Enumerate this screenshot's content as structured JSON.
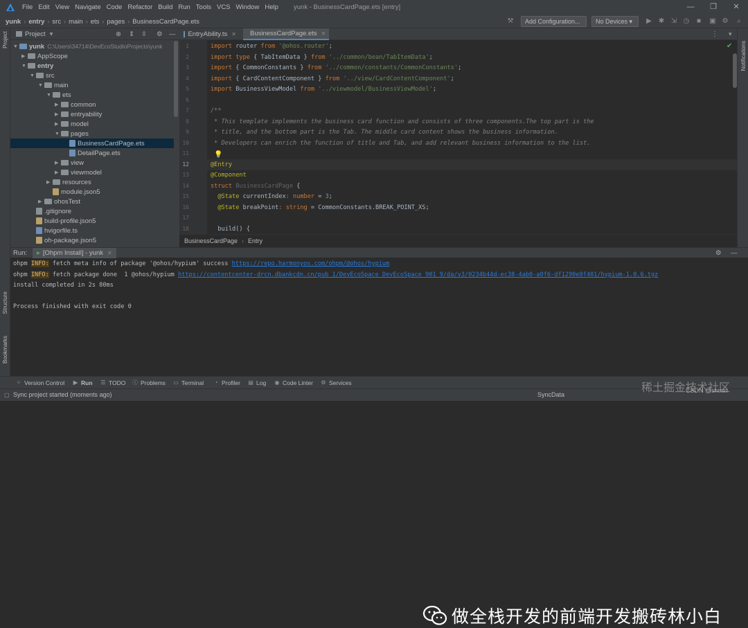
{
  "menubar": {
    "items": [
      "File",
      "Edit",
      "View",
      "Navigate",
      "Code",
      "Refactor",
      "Build",
      "Run",
      "Tools",
      "VCS",
      "Window",
      "Help"
    ],
    "window_title": "yunk - BusinessCardPage.ets [entry]"
  },
  "navbar": {
    "crumbs": [
      "yunk",
      "entry",
      "src",
      "main",
      "ets",
      "pages",
      "BusinessCardPage.ets"
    ],
    "add_config_label": "Add Configuration...",
    "devices_label": "No Devices"
  },
  "left_strip": {
    "project_label": "Project",
    "structure_label": "Structure",
    "bookmarks_label": "Bookmarks"
  },
  "right_strip": {
    "notifications_label": "Notifications"
  },
  "project": {
    "header_label": "Project",
    "tree": [
      {
        "label": "yunk",
        "extra": "C:\\Users\\34714\\DevEcoStudioProjects\\yunk",
        "depth": 0,
        "kind": "folder",
        "open": true
      },
      {
        "label": "AppScope",
        "depth": 1,
        "kind": "folder",
        "open": false
      },
      {
        "label": "entry",
        "depth": 1,
        "kind": "folder",
        "open": true
      },
      {
        "label": "src",
        "depth": 2,
        "kind": "folder",
        "open": true
      },
      {
        "label": "main",
        "depth": 3,
        "kind": "folder",
        "open": true
      },
      {
        "label": "ets",
        "depth": 4,
        "kind": "folder",
        "open": true
      },
      {
        "label": "common",
        "depth": 5,
        "kind": "folder",
        "open": false
      },
      {
        "label": "entryability",
        "depth": 5,
        "kind": "folder",
        "open": false
      },
      {
        "label": "model",
        "depth": 5,
        "kind": "folder",
        "open": false
      },
      {
        "label": "pages",
        "depth": 5,
        "kind": "folder",
        "open": true
      },
      {
        "label": "BusinessCardPage.ets",
        "depth": 6,
        "kind": "ets",
        "selected": true
      },
      {
        "label": "DetailPage.ets",
        "depth": 6,
        "kind": "ets"
      },
      {
        "label": "view",
        "depth": 5,
        "kind": "folder",
        "open": false
      },
      {
        "label": "viewmodel",
        "depth": 5,
        "kind": "folder",
        "open": false
      },
      {
        "label": "resources",
        "depth": 4,
        "kind": "folder",
        "open": false
      },
      {
        "label": "module.json5",
        "depth": 4,
        "kind": "json"
      },
      {
        "label": "ohosTest",
        "depth": 3,
        "kind": "folder",
        "open": false
      },
      {
        "label": ".gitignore",
        "depth": 2,
        "kind": "text"
      },
      {
        "label": "build-profile.json5",
        "depth": 2,
        "kind": "json"
      },
      {
        "label": "hvigorfile.ts",
        "depth": 2,
        "kind": "ts"
      },
      {
        "label": "oh-package.json5",
        "depth": 2,
        "kind": "json"
      }
    ]
  },
  "editor": {
    "tabs": [
      {
        "label": "EntryAbility.ts",
        "active": false
      },
      {
        "label": "BusinessCardPage.ets",
        "active": true
      }
    ],
    "current_line": "12",
    "line_numbers": [
      "1",
      "2",
      "3",
      "4",
      "5",
      "6",
      "7",
      "8",
      "9",
      "10",
      "11",
      "12",
      "13",
      "14",
      "15",
      "16",
      "17",
      "18"
    ],
    "lines": [
      [
        [
          "kw",
          "import "
        ],
        [
          "cls",
          "router "
        ],
        [
          "kw",
          "from "
        ],
        [
          "str",
          "'@ohos.router'"
        ],
        [
          "cls",
          ";"
        ]
      ],
      [
        [
          "kw",
          "import type "
        ],
        [
          "cls",
          "{ TabItemData } "
        ],
        [
          "kw",
          "from "
        ],
        [
          "str",
          "'../common/bean/TabItemData'"
        ],
        [
          "cls",
          ";"
        ]
      ],
      [
        [
          "kw",
          "import "
        ],
        [
          "cls",
          "{ CommonConstants } "
        ],
        [
          "kw",
          "from "
        ],
        [
          "str",
          "'../common/constants/CommonConstants'"
        ],
        [
          "cls",
          ";"
        ]
      ],
      [
        [
          "kw",
          "import "
        ],
        [
          "cls",
          "{ CardContentComponent } "
        ],
        [
          "kw",
          "from "
        ],
        [
          "str",
          "'../view/CardContentComponent'"
        ],
        [
          "cls",
          ";"
        ]
      ],
      [
        [
          "kw",
          "import "
        ],
        [
          "cls",
          "BusinessViewModel "
        ],
        [
          "kw",
          "from "
        ],
        [
          "str",
          "'../viewmodel/BusinessViewModel'"
        ],
        [
          "cls",
          ";"
        ]
      ],
      [],
      [
        [
          "cmt",
          "/**"
        ]
      ],
      [
        [
          "cmt",
          " * This template implements the business card function and consists of three components.The top part is the"
        ]
      ],
      [
        [
          "cmt",
          " * title, and the bottom part is the Tab. The middle card content shows the business information."
        ]
      ],
      [
        [
          "cmt",
          " * Developers can enrich the function of title and Tab, and add relevant business information to the list."
        ]
      ],
      [],
      [
        [
          "ann",
          "@Entry"
        ]
      ],
      [
        [
          "ann",
          "@Component"
        ]
      ],
      [
        [
          "kw",
          "struct "
        ],
        [
          "grey",
          "BusinessCardPage "
        ],
        [
          "cls",
          "{"
        ]
      ],
      [
        [
          "ann",
          "  @State "
        ],
        [
          "cls",
          "currentIndex"
        ],
        [
          "kw",
          ": "
        ],
        [
          "typ",
          "number "
        ],
        [
          "cls",
          "= "
        ],
        [
          "num",
          "3"
        ],
        [
          "cls",
          ";"
        ]
      ],
      [
        [
          "ann",
          "  @State "
        ],
        [
          "cls",
          "breakPoint"
        ],
        [
          "kw",
          ": "
        ],
        [
          "typ",
          "string "
        ],
        [
          "cls",
          "= CommonConstants.BREAK_POINT_XS;"
        ]
      ],
      [],
      [
        [
          "cls",
          "  build() {"
        ]
      ]
    ],
    "breadcrumb": [
      "BusinessCardPage",
      "Entry"
    ]
  },
  "run": {
    "label": "Run:",
    "tab_label": "[Ohpm Install] - yunk",
    "console": [
      {
        "prefix": "ohpm",
        "tag": "INFO:",
        "text": " fetch meta info of package '@ohos/hypium' success ",
        "link": "https://repo.harmonyos.com/ohpm/@ohos/hypium"
      },
      {
        "prefix": "ohpm",
        "tag": "INFO:",
        "text": " fetch package done  1 @ohos/hypium ",
        "link": "https://contentcenter-drcn.dbankcdn.cn/pub_1/DevEcoSpace_DevEcoSpace_901_9/da/v3/0234b44d-ec38-4ab0-a0f6-df1290e8f401/hypium-1.0.6.tgz"
      },
      {
        "prefix": "",
        "tag": "",
        "text": "install completed in 2s 80ms",
        "link": ""
      },
      {
        "prefix": "",
        "tag": "",
        "text": "",
        "link": ""
      },
      {
        "prefix": "",
        "tag": "",
        "text": "Process finished with exit code 0",
        "link": ""
      }
    ]
  },
  "watermark": {
    "text": "做全栈开发的前端开发搬砖林小白"
  },
  "bottom_tools": [
    "Version Control",
    "Run",
    "TODO",
    "Problems",
    "Terminal",
    "Profiler",
    "Log",
    "Code Linter",
    "Services"
  ],
  "status": {
    "left": "Sync project started (moments ago)",
    "right": "SyncData",
    "site": "稀土掘金技术社区",
    "csdn": "CSDN @shinin"
  }
}
